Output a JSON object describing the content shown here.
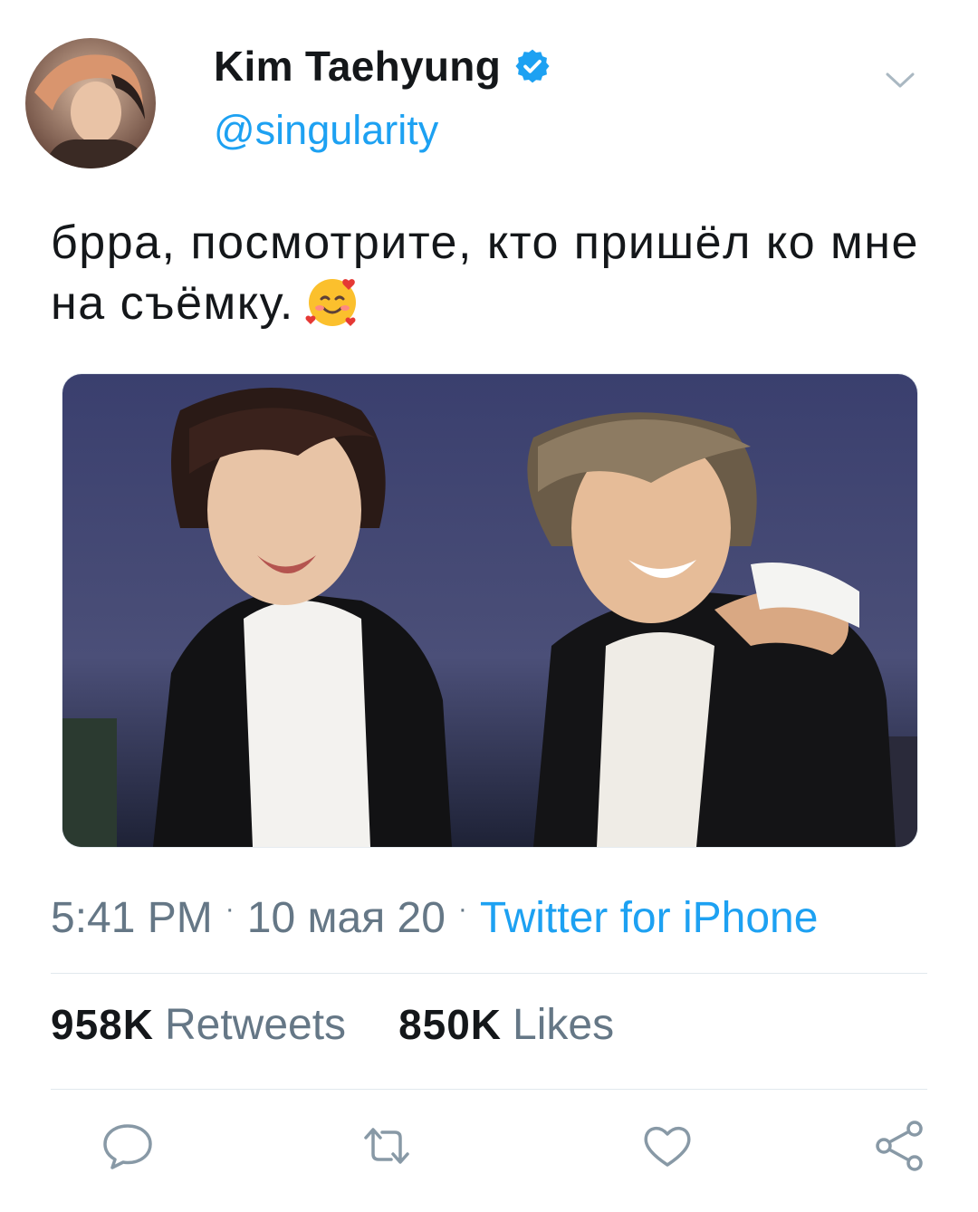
{
  "author": {
    "name": "Kim Taehyung",
    "handle": "@singularity",
    "verified_icon": "verified-badge-icon",
    "avatar_icon": "avatar"
  },
  "tweet": {
    "text": "брра, посмотрите, кто пришёл ко мне на съёмку.",
    "emoji_icon": "smiling-face-with-hearts-icon",
    "photo": "photo-two-people-in-black-suits"
  },
  "meta": {
    "time": "5:41 PM",
    "date": "10 мая 20",
    "separator": "·",
    "source": "Twitter for iPhone"
  },
  "stats": {
    "retweets_count": "958K",
    "retweets_label": "Retweets",
    "likes_count": "850K",
    "likes_label": "Likes"
  },
  "actions": [
    "reply-icon",
    "retweet-icon",
    "like-icon",
    "share-icon"
  ],
  "colors": {
    "accent": "#1da1f2",
    "text": "#14171a",
    "secondary": "#657786",
    "divider": "#e1e8ed"
  }
}
